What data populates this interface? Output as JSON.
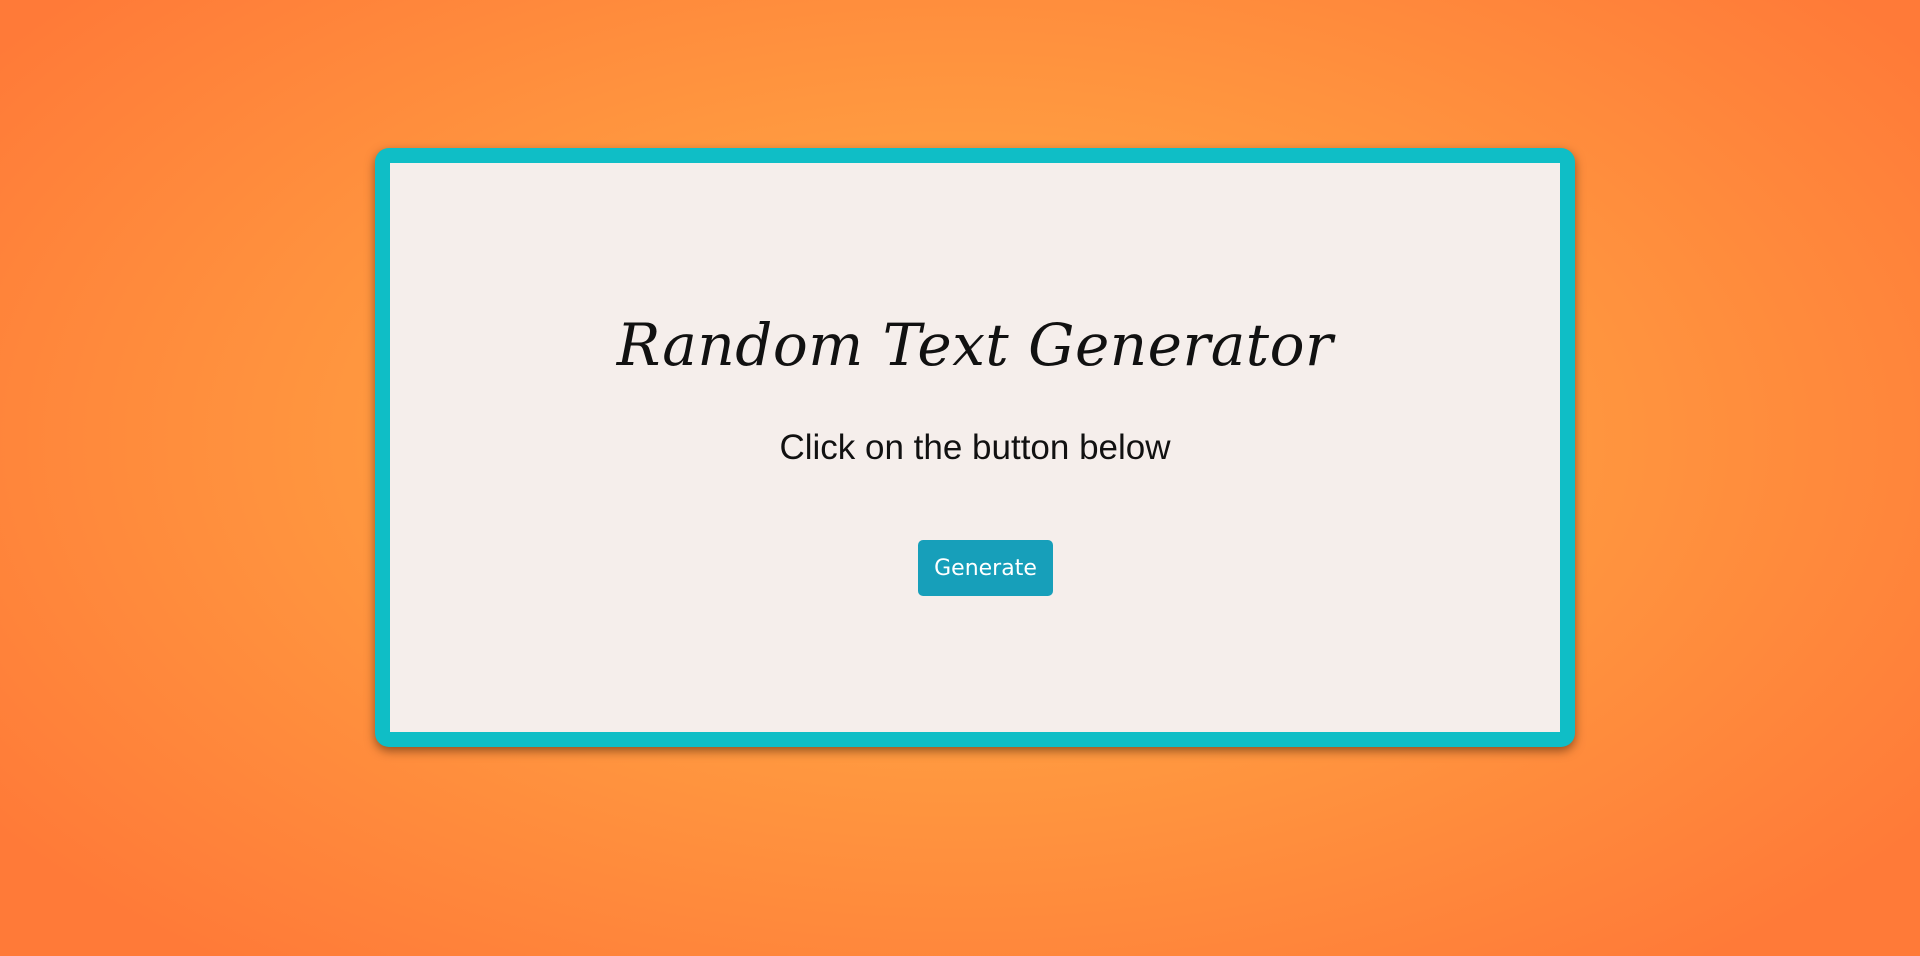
{
  "card": {
    "title": "Random Text Generator",
    "subtitle": "Click on the button below",
    "generate_label": "Generate"
  },
  "colors": {
    "background_center": "#ffaa4a",
    "background_edge": "#ff7a38",
    "card_border": "#0fbec6",
    "card_fill": "#f5eeeb",
    "button": "#179fba",
    "button_text": "#ffffff",
    "text": "#111111"
  }
}
